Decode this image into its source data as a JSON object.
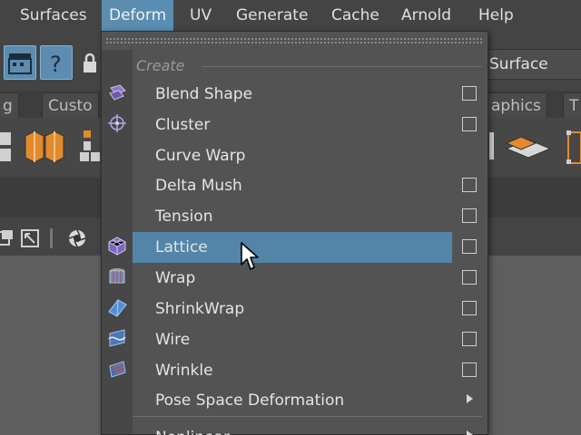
{
  "menubar": {
    "items": [
      {
        "label": "Surfaces"
      },
      {
        "label": "Deform"
      },
      {
        "label": "UV"
      },
      {
        "label": "Generate"
      },
      {
        "label": "Cache"
      },
      {
        "label": "Arnold"
      },
      {
        "label": "Help"
      }
    ]
  },
  "status_line": {
    "make_live_label": "Surface"
  },
  "shelf_tabs": [
    {
      "label": "g"
    },
    {
      "label": "Custo"
    },
    {
      "label": "aphics"
    },
    {
      "label": "T"
    }
  ],
  "deform_menu": {
    "section_label": "Create",
    "items": [
      {
        "label": "Blend Shape",
        "option_box": true,
        "icon": "blend-shape-icon"
      },
      {
        "label": "Cluster",
        "option_box": true,
        "icon": "cluster-icon"
      },
      {
        "label": "Curve Warp",
        "option_box": false
      },
      {
        "label": "Delta Mush",
        "option_box": true
      },
      {
        "label": "Tension",
        "option_box": true
      },
      {
        "label": "Lattice",
        "option_box": true,
        "icon": "lattice-icon",
        "highlighted": true
      },
      {
        "label": "Wrap",
        "option_box": true,
        "icon": "wrap-icon"
      },
      {
        "label": "ShrinkWrap",
        "option_box": true,
        "icon": "shrinkwrap-icon"
      },
      {
        "label": "Wire",
        "option_box": true,
        "icon": "wire-icon"
      },
      {
        "label": "Wrinkle",
        "option_box": true,
        "icon": "wrinkle-icon"
      },
      {
        "label": "Pose Space Deformation",
        "submenu": true
      }
    ],
    "partial_item": "Nonlinear"
  },
  "colors": {
    "highlight": "#5285a8",
    "menubar_active": "#5a8db0",
    "menu_bg": "#535353"
  }
}
